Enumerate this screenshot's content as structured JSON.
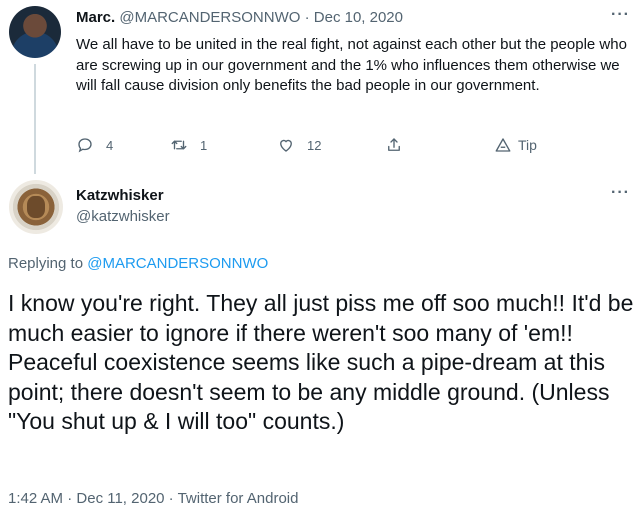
{
  "parent_tweet": {
    "name": "Marc.",
    "handle": "@MARCANDERSONNWO",
    "separator": " · ",
    "date": "Dec 10, 2020",
    "text": "We all have to be united in the real fight, not against each other but the people who are screwing up in our government and the 1% who influences them otherwise we will fall cause division only benefits the bad people in our government.",
    "more_label": "···",
    "actions": {
      "reply_count": "4",
      "retweet_count": "1",
      "like_count": "12",
      "tip_label": "Tip"
    }
  },
  "reply_tweet": {
    "name": "Katzwhisker",
    "handle": "@katzwhisker",
    "more_label": "···",
    "replying_prefix": "Replying to ",
    "replying_handle": "@MARCANDERSONNWO",
    "text": "I know you're right. They all just piss me off soo much!! It'd be much easier to ignore if there weren't soo many of 'em!!  Peaceful coexistence seems like such a pipe-dream at this point; there doesn't seem to be any middle ground. (Unless \"You shut up & I will too\" counts.)",
    "time": "1:42 AM",
    "separator": " · ",
    "date": "Dec 11, 2020",
    "source": "Twitter for Android"
  },
  "colors": {
    "text": "#0f1419",
    "secondary": "#536471",
    "link": "#1d9bf0",
    "thread_line": "#cfd9de"
  }
}
